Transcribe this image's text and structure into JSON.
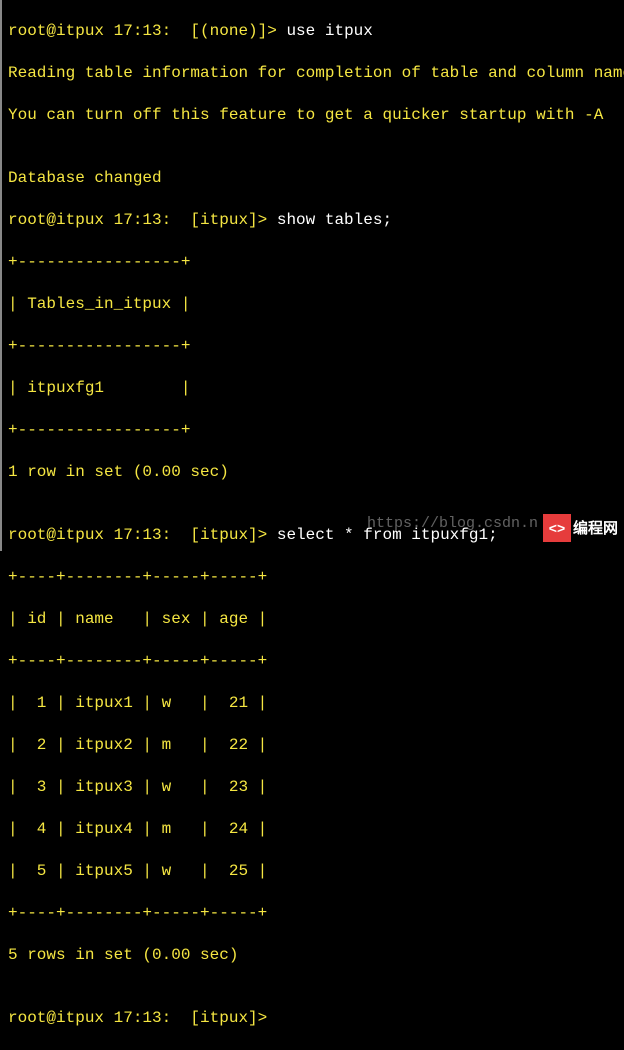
{
  "prompts": {
    "p1_prompt": "root@itpux 17:13:  [(none)]> ",
    "p1_cmd": "use itpux",
    "line2": "Reading table information for completion of table and column names",
    "line3": "You can turn off this feature to get a quicker startup with -A",
    "line4": "",
    "line5": "Database changed",
    "p2_prompt": "root@itpux 17:13:  [itpux]> ",
    "p2_cmd": "show tables;",
    "t1_border": "+-----------------+",
    "t1_header": "| Tables_in_itpux |",
    "t1_row1": "| itpuxfg1        |",
    "t1_footer": "1 row in set (0.00 sec)",
    "blank2": "",
    "p3_prompt": "root@itpux 17:13:  [itpux]> ",
    "p3_cmd": "select * from itpuxfg1;",
    "t2_border": "+----+--------+-----+-----+",
    "t2_header": "| id | name   | sex | age |",
    "t2_r1": "|  1 | itpux1 | w   |  21 |",
    "t2_r2": "|  2 | itpux2 | m   |  22 |",
    "t2_r3": "|  3 | itpux3 | w   |  23 |",
    "t2_r4": "|  4 | itpux4 | m   |  24 |",
    "t2_r5": "|  5 | itpux5 | w   |  25 |",
    "t2_footer": "5 rows in set (0.00 sec)",
    "blank3": "",
    "p4_prompt": "root@itpux 17:13:  [itpux]> "
  },
  "watermark": "https://blog.csdn.n",
  "logo": {
    "icon_text": "<>",
    "brand_text": "编程网"
  }
}
